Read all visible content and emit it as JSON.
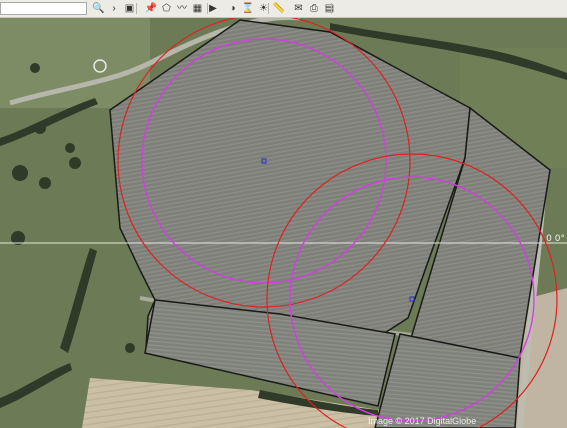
{
  "toolbar": {
    "search_value": "",
    "buttons": [
      {
        "name": "search-icon",
        "glyph": "🔍"
      },
      {
        "name": "nav-arrow-icon",
        "glyph": "›"
      },
      {
        "name": "sidebar-panel-icon",
        "glyph": "▣"
      },
      {
        "name": "placemark-icon",
        "glyph": "📌"
      },
      {
        "name": "polygon-icon",
        "glyph": "⬠"
      },
      {
        "name": "path-icon",
        "glyph": "〰"
      },
      {
        "name": "overlay-icon",
        "glyph": "▦"
      },
      {
        "name": "tour-icon",
        "glyph": "▶"
      },
      {
        "name": "sky-icon",
        "glyph": "◑"
      },
      {
        "name": "historical-imagery-icon",
        "glyph": "⌛"
      },
      {
        "name": "sunlight-icon",
        "glyph": "☀"
      },
      {
        "name": "ruler-icon",
        "glyph": "📏"
      },
      {
        "name": "email-icon",
        "glyph": "✉"
      },
      {
        "name": "print-icon",
        "glyph": "⎙"
      },
      {
        "name": "save-image-icon",
        "glyph": "▤"
      }
    ]
  },
  "map": {
    "layer": "satellite-imagery",
    "overlay_colors": {
      "circle_outer": "#e02020",
      "circle_inner": "#d040e0",
      "marker": "#2030e0",
      "field_outline": "#1a1a1a",
      "grid_line": "#dddddd"
    },
    "grid_label": "0 0°",
    "attribution": "Image © 2017 DigitalGlobe"
  }
}
